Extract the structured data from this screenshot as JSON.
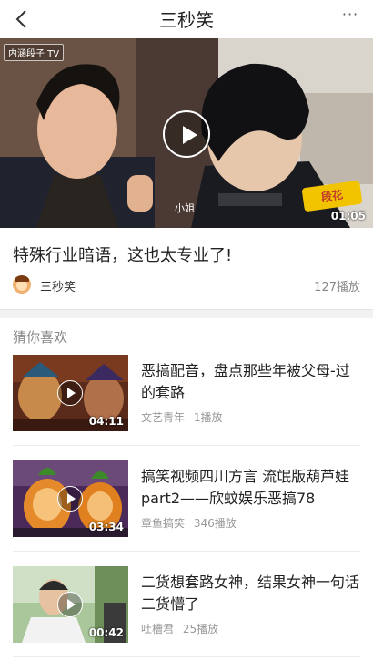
{
  "nav": {
    "title": "三秒笑",
    "more": "···"
  },
  "player": {
    "channel_badge": "内涵段子 TV",
    "caption_word": "小姐",
    "logo_text": "段花",
    "duration": "01:05"
  },
  "video": {
    "title": "特殊行业暗语，这也太专业了!",
    "author": "三秒笑",
    "plays": "127播放"
  },
  "recommend": {
    "section_title": "猜你喜欢",
    "items": [
      {
        "title": "恶搞配音，盘点那些年被父母-过的套路",
        "author": "文艺青年",
        "plays": "1播放",
        "duration": "04:11"
      },
      {
        "title": "搞笑视频四川方言 流氓版葫芦娃part2——欣蚊娱乐恶搞78",
        "author": "章鱼搞笑",
        "plays": "346播放",
        "duration": "03:34"
      },
      {
        "title": "二货想套路女神，结果女神一句话二货懵了",
        "author": "吐槽君",
        "plays": "25播放",
        "duration": "00:42"
      }
    ]
  },
  "colors": {
    "separator": "#f2f2f2",
    "meta_text": "#999999",
    "title_text": "#222222"
  }
}
